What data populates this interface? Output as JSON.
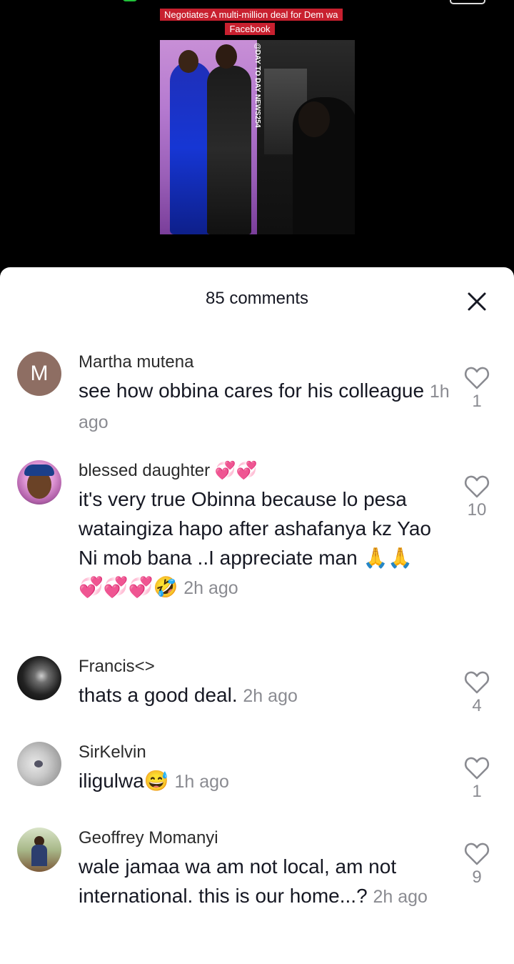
{
  "video": {
    "caption": "Negotiates A multi-million deal for Dem wa Facebook",
    "watermark": "@DAY TO DAY NEWS254"
  },
  "sheet": {
    "comment_count": "85 comments",
    "close_icon": "close-icon"
  },
  "comments": [
    {
      "user": "Martha mutena",
      "avatar_letter": "M",
      "avatar_color": "#8e6e63",
      "text": "see how obbina cares for his colleague",
      "time": "1h ago",
      "likes": "1"
    },
    {
      "user": "blessed daughter 💞💞",
      "text": "it's very true Obinna because lo pesa wataingiza hapo after ashafanya kz Yao Ni mob bana ..I appreciate man 🙏🙏💞💞💞🤣",
      "time": "2h ago",
      "likes": "10"
    },
    {
      "user": "Francis<>",
      "text": "thats a good deal.",
      "time": "2h ago",
      "likes": "4"
    },
    {
      "user": "SirKelvin",
      "text": "iligulwa😅",
      "time": "1h ago",
      "likes": "1"
    },
    {
      "user": "Geoffrey Momanyi",
      "text": "wale jamaa wa am not local, am not international. this is our home...?",
      "time": "2h ago",
      "likes": "9"
    }
  ]
}
